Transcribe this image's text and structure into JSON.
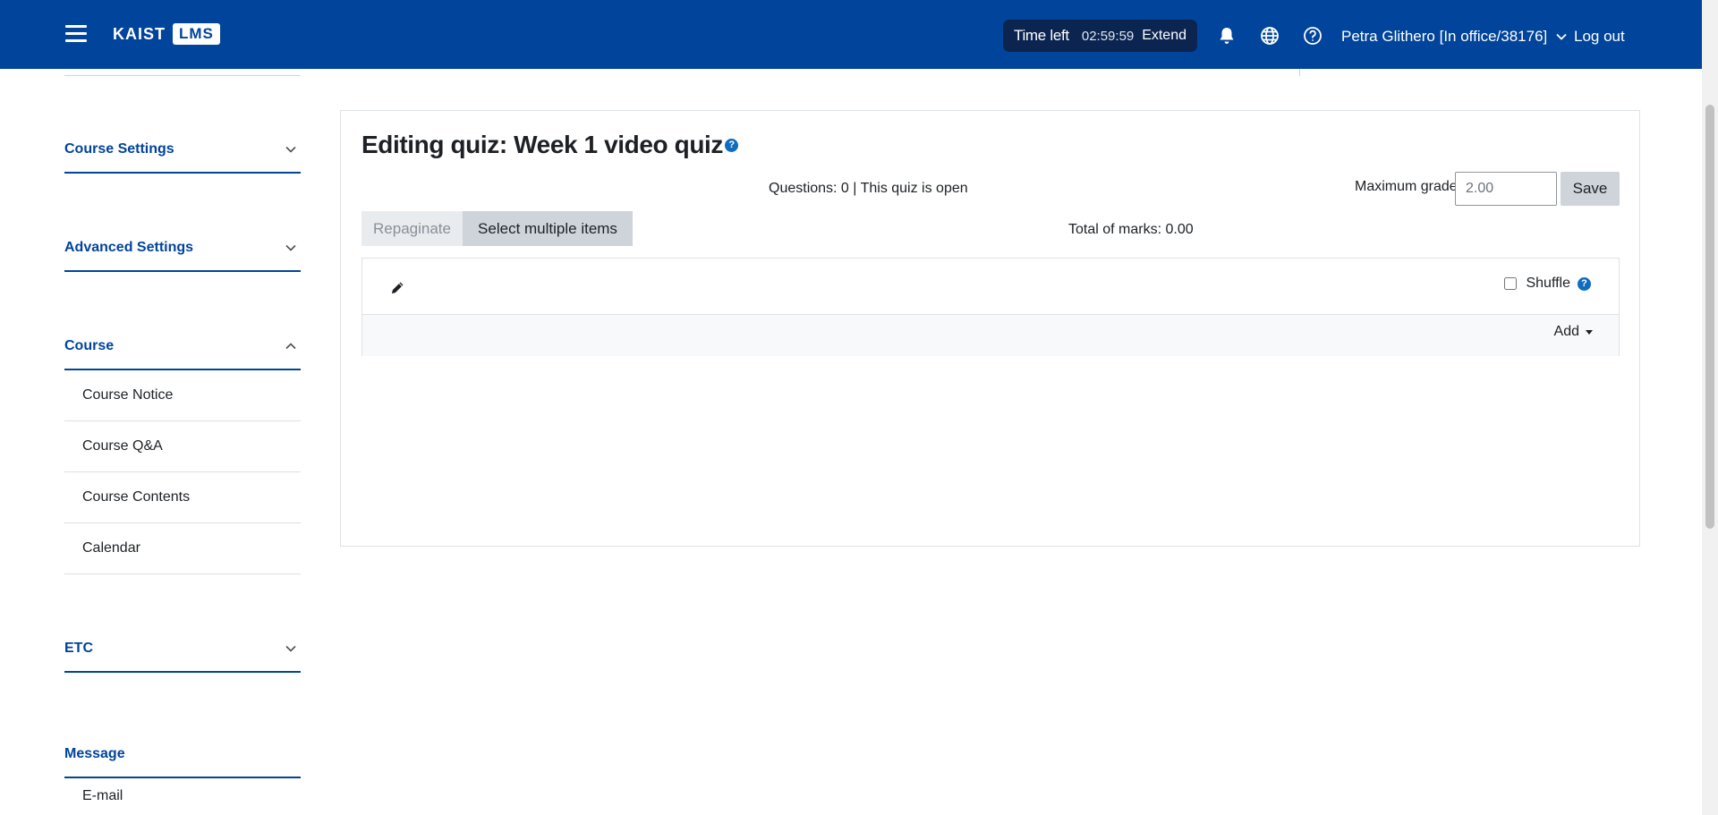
{
  "header": {
    "logo_left": "KAIST",
    "logo_right": "LMS",
    "timer_label": "Time left",
    "timer_value": "02:59:59",
    "extend_label": "Extend",
    "user_name": "Petra Glithero [In office/38176]",
    "logout_label": "Log out",
    "icons": [
      "menu-icon",
      "bell-icon",
      "globe-icon",
      "help-circle-icon"
    ]
  },
  "sidebar": {
    "sections": [
      {
        "label": "Course Settings",
        "expanded": false
      },
      {
        "label": "Advanced Settings",
        "expanded": false
      },
      {
        "label": "Course",
        "expanded": true,
        "items": [
          "Course Notice",
          "Course Q&A",
          "Course Contents",
          "Calendar"
        ]
      },
      {
        "label": "ETC",
        "expanded": false
      },
      {
        "label": "Message",
        "items": [
          "E-mail"
        ]
      }
    ]
  },
  "main": {
    "title": "Editing quiz: Week 1 video quiz",
    "status": "Questions: 0 | This quiz is open",
    "max_grade_label": "Maximum grade",
    "max_grade_value": "2.00",
    "save_label": "Save",
    "repaginate_label": "Repaginate",
    "select_multiple_label": "Select multiple items",
    "total_marks": "Total of marks: 0.00",
    "shuffle_label": "Shuffle",
    "add_label": "Add"
  },
  "colors": {
    "brand": "#00449b",
    "timer_bg": "#0b2550",
    "help": "#0f6cbf"
  }
}
